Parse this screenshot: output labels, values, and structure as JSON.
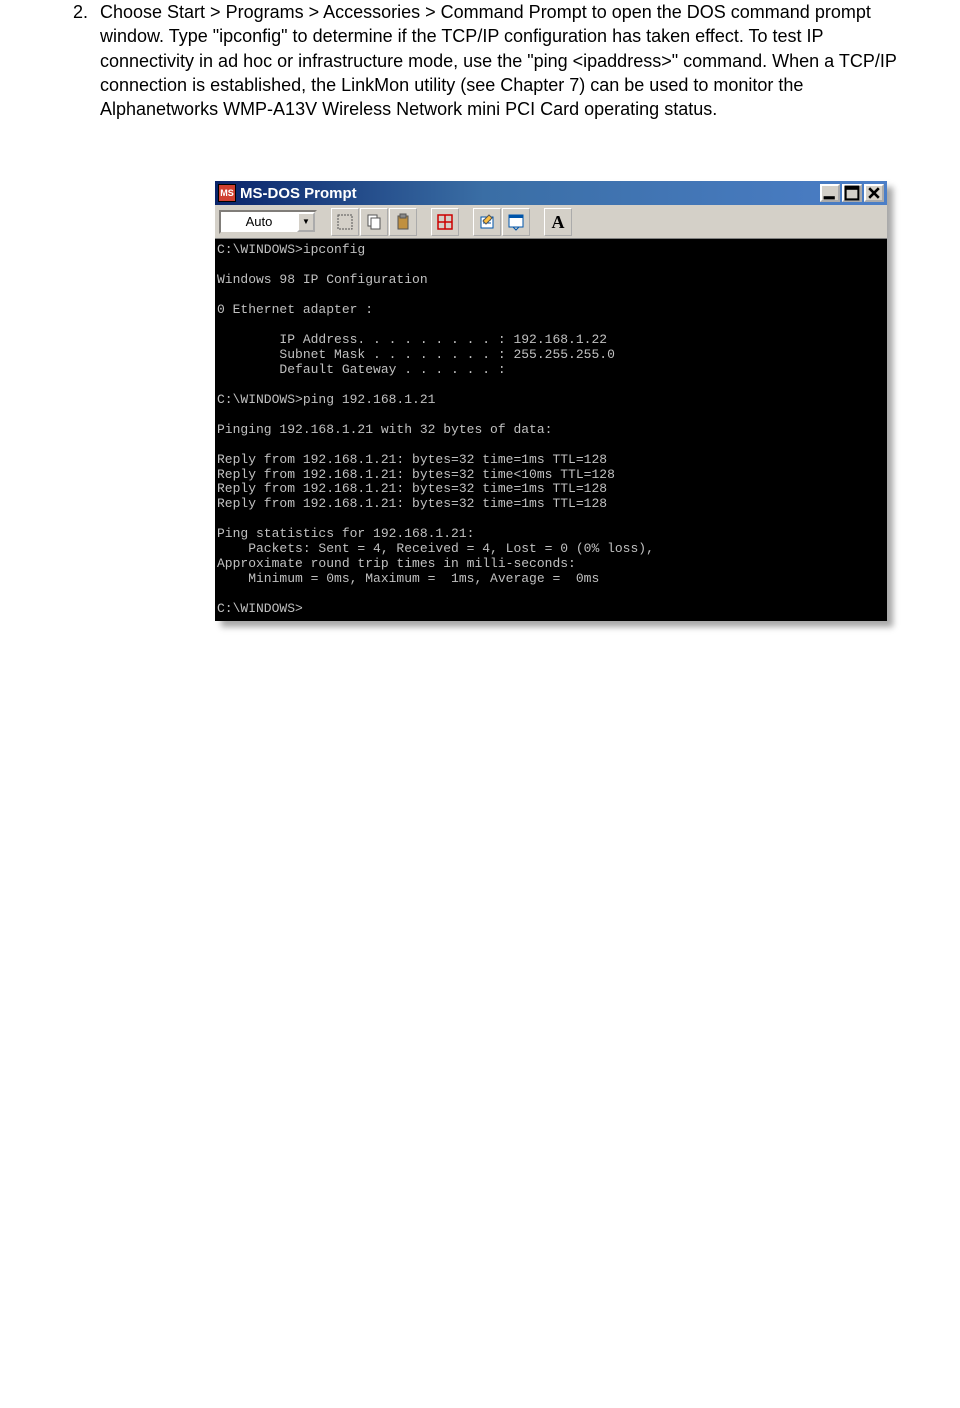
{
  "instruction": {
    "number": "2.",
    "text": "Choose Start > Programs > Accessories > Command Prompt to open the DOS command prompt window. Type \"ipconfig\" to determine if the TCP/IP configuration has taken effect. To test IP connectivity in ad hoc or infrastructure mode, use the \"ping <ipaddress>\" command. When a TCP/IP connection is established, the LinkMon utility (see Chapter 7) can be used to monitor the Alphanetworks WMP-A13V Wireless Network mini PCI Card operating status."
  },
  "window": {
    "icon_label": "MS",
    "title": "MS-DOS Prompt"
  },
  "toolbar": {
    "combo_value": "Auto"
  },
  "terminal": {
    "lines": [
      {
        "class": "",
        "text": "C:\\WINDOWS>ipconfig"
      },
      {
        "class": "",
        "text": ""
      },
      {
        "class": "",
        "text": "Windows 98 IP Configuration"
      },
      {
        "class": "",
        "text": ""
      },
      {
        "class": "",
        "text": "0 Ethernet adapter :"
      },
      {
        "class": "",
        "text": ""
      },
      {
        "class": "",
        "text": "        IP Address. . . . . . . . . : 192.168.1.22"
      },
      {
        "class": "",
        "text": "        Subnet Mask . . . . . . . . : 255.255.255.0"
      },
      {
        "class": "",
        "text": "        Default Gateway . . . . . . :"
      },
      {
        "class": "",
        "text": ""
      },
      {
        "class": "",
        "text": "C:\\WINDOWS>ping 192.168.1.21"
      },
      {
        "class": "",
        "text": ""
      },
      {
        "class": "",
        "text": "Pinging 192.168.1.21 with 32 bytes of data:"
      },
      {
        "class": "",
        "text": ""
      },
      {
        "class": "",
        "text": "Reply from 192.168.1.21: bytes=32 time=1ms TTL=128"
      },
      {
        "class": "",
        "text": "Reply from 192.168.1.21: bytes=32 time<10ms TTL=128"
      },
      {
        "class": "",
        "text": "Reply from 192.168.1.21: bytes=32 time=1ms TTL=128"
      },
      {
        "class": "",
        "text": "Reply from 192.168.1.21: bytes=32 time=1ms TTL=128"
      },
      {
        "class": "",
        "text": ""
      },
      {
        "class": "",
        "text": "Ping statistics for 192.168.1.21:"
      },
      {
        "class": "",
        "text": "    Packets: Sent = 4, Received = 4, Lost = 0 (0% loss),"
      },
      {
        "class": "",
        "text": "Approximate round trip times in milli-seconds:"
      },
      {
        "class": "",
        "text": "    Minimum = 0ms, Maximum =  1ms, Average =  0ms"
      },
      {
        "class": "",
        "text": ""
      },
      {
        "class": "",
        "text": "C:\\WINDOWS>"
      }
    ]
  }
}
